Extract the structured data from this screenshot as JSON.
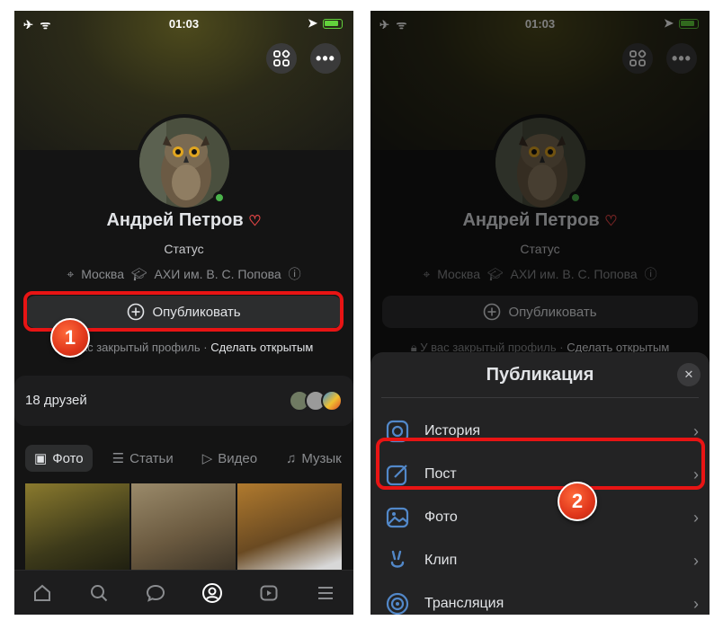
{
  "status_bar": {
    "time": "01:03"
  },
  "profile": {
    "name": "Андрей Петров",
    "status": "Статус",
    "city": "Москва",
    "school": "АХИ им. В. С. Попова",
    "publish_label": "Опубликовать",
    "closed_text": "У вас закрытый профиль",
    "closed_sep": "·",
    "make_open_label": "Сделать открытым"
  },
  "friends": {
    "label": "18 друзей"
  },
  "tabs": [
    "Фото",
    "Статьи",
    "Видео",
    "Музык"
  ],
  "steps": [
    "1",
    "2"
  ],
  "sheet": {
    "title": "Публикация",
    "items": [
      "История",
      "Пост",
      "Фото",
      "Клип",
      "Трансляция"
    ]
  },
  "colors": {
    "accent": "#5288c9",
    "highlight": "#e81414",
    "online": "#4bb34b",
    "background": "#141414"
  }
}
